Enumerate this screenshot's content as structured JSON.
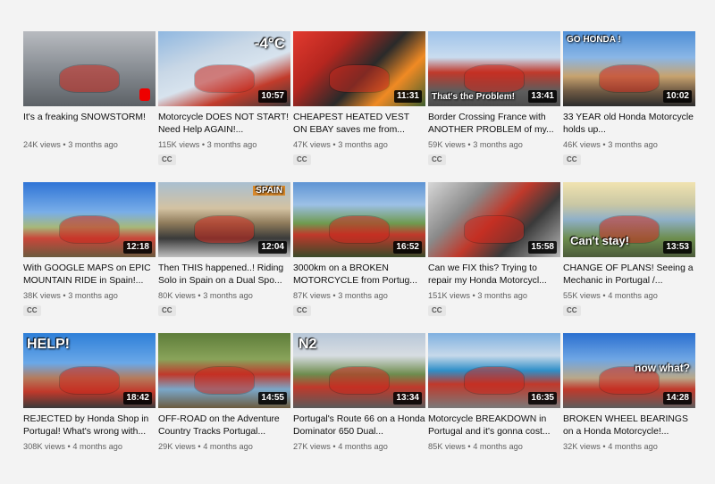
{
  "videos": [
    {
      "title": "It's a freaking SNOWSTORM!",
      "views": "24K views",
      "age": "3 months ago",
      "duration": "",
      "cc": false,
      "overlay": "",
      "bg": "linear-gradient(180deg,#b8bbc0 0%,#8d9298 45%,#5c6166 100%)",
      "shorts": true
    },
    {
      "title": "Motorcycle DOES NOT START! Need Help AGAIN!...",
      "views": "115K views",
      "age": "3 months ago",
      "duration": "10:57",
      "cc": true,
      "overlay": "-4°C",
      "bg": "linear-gradient(160deg,#8fb7e0 0%,#c8d7e6 35%,#d7e3ee 55%,#c23b2b 75%,#3b3a3a 100%)"
    },
    {
      "title": "CHEAPEST HEATED VEST ON EBAY saves me from...",
      "views": "47K views",
      "age": "3 months ago",
      "duration": "11:31",
      "cc": true,
      "overlay": "",
      "bg": "linear-gradient(135deg,#e23a2f 0%,#b5261f 30%,#2a2a2a 55%,#f08a24 75%,#3e5e2f 100%)"
    },
    {
      "title": "Border Crossing France with ANOTHER PROBLEM of my...",
      "views": "59K views",
      "age": "3 months ago",
      "duration": "13:41",
      "cc": true,
      "overlay": "That's the Problem!",
      "bg": "linear-gradient(180deg,#9fc3ea 0%,#c9dcef 35%,#c0392b 55%,#5d5d5d 80%,#4b4b4b 100%)"
    },
    {
      "title": "33 YEAR old Honda Motorcycle holds up...",
      "views": "46K views",
      "age": "3 months ago",
      "duration": "10:02",
      "cc": true,
      "overlay": "GO HONDA !",
      "bg": "linear-gradient(180deg,#4f8fd6 0%,#8ab6e6 35%,#c7a36f 60%,#6f5a44 80%,#2c2c2c 100%)"
    },
    {
      "title": "With GOOGLE MAPS on EPIC MOUNTAIN RIDE in Spain!...",
      "views": "38K views",
      "age": "3 months ago",
      "duration": "12:18",
      "cc": true,
      "overlay": "",
      "bg": "linear-gradient(180deg,#2f74d6 0%,#79aee8 40%,#a7b87a 60%,#c9473a 75%,#6b5a3e 100%)"
    },
    {
      "title": "Then THIS happened..! Riding Solo in Spain on a Dual Spo...",
      "views": "80K views",
      "age": "3 months ago",
      "duration": "12:04",
      "cc": true,
      "overlay": "SPAIN",
      "bg": "linear-gradient(180deg,#a9bfd0 0%,#d3c2a2 35%,#8e7a5a 55%,#3a3a3a 75%,#bfbfbf 100%)"
    },
    {
      "title": "3000km on a BROKEN MOTORCYCLE from Portug...",
      "views": "87K views",
      "age": "3 months ago",
      "duration": "16:52",
      "cc": true,
      "overlay": "",
      "bg": "linear-gradient(180deg,#5e94d4 0%,#9cc0e6 30%,#6f9a4f 55%,#c0392b 70%,#3a4a2a 100%)"
    },
    {
      "title": "Can we FIX this? Trying to repair my Honda Motorcycl...",
      "views": "151K views",
      "age": "3 months ago",
      "duration": "15:58",
      "cc": true,
      "overlay": "",
      "bg": "linear-gradient(135deg,#d7d7d7 0%,#8a8a8a 30%,#c0392b 50%,#3a3a3a 70%,#b8b8b8 100%)"
    },
    {
      "title": "CHANGE OF PLANS! Seeing a Mechanic in Portugal /...",
      "views": "55K views",
      "age": "4 months ago",
      "duration": "13:53",
      "cc": true,
      "overlay": "Can't stay!",
      "bg": "linear-gradient(180deg,#f1e3b0 0%,#c9c7a4 30%,#8fb0c9 50%,#6d8d4e 75%,#4b5a3a 100%)"
    },
    {
      "title": "REJECTED by Honda Shop in Portugal! What's wrong with...",
      "views": "308K views",
      "age": "4 months ago",
      "duration": "18:42",
      "cc": false,
      "overlay": "HELP!",
      "bg": "linear-gradient(180deg,#2e7fd8 0%,#6aa8e8 40%,#b57b5c 60%,#c0392b 78%,#3a3a3a 100%)"
    },
    {
      "title": "OFF-ROAD on the Adventure Country Tracks Portugal...",
      "views": "29K views",
      "age": "4 months ago",
      "duration": "14:55",
      "cc": false,
      "overlay": "",
      "bg": "linear-gradient(180deg,#5e7d3a 0%,#89a35a 35%,#c0392b 55%,#7aa7c9 75%,#6b5a3e 100%)"
    },
    {
      "title": "Portugal's Route 66 on a Honda Dominator 650 Dual...",
      "views": "27K views",
      "age": "4 months ago",
      "duration": "13:34",
      "cc": false,
      "overlay": "N2",
      "bg": "linear-gradient(180deg,#b7c7d8 0%,#d8dde2 30%,#6e8c4e 55%,#c0392b 72%,#5a5a5a 100%)"
    },
    {
      "title": "Motorcycle BREAKDOWN in Portugal and it's gonna cost...",
      "views": "85K views",
      "age": "4 months ago",
      "duration": "16:35",
      "cc": false,
      "overlay": "",
      "bg": "linear-gradient(180deg,#7fb0e0 0%,#c7d9ea 30%,#2f8fc8 50%,#c0392b 68%,#7a7a7a 100%)"
    },
    {
      "title": "BROKEN WHEEL BEARINGS on a Honda Motorcycle!...",
      "views": "32K views",
      "age": "4 months ago",
      "duration": "14:28",
      "cc": false,
      "overlay": "now what?",
      "bg": "linear-gradient(180deg,#2a6fd0 0%,#6fa6e4 35%,#b9a88a 60%,#c0392b 75%,#5d5d5d 100%)"
    }
  ],
  "labels": {
    "cc": "CC",
    "separator": " • "
  }
}
